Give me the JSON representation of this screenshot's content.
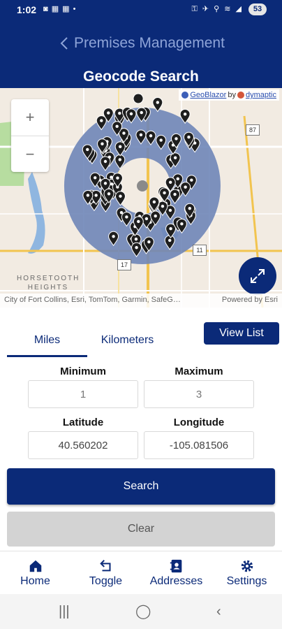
{
  "status_bar": {
    "time": "1:02",
    "left_icons": "◙ ▦ ▦ •",
    "right_icons": "⚿ ✈ ⚲ ≋ ◢",
    "battery": "53"
  },
  "header": {
    "back_label": "Premises Management",
    "title": "Geocode Search"
  },
  "map": {
    "attribution_brand": "GeoBlazor",
    "attribution_by": "by",
    "attribution_vendor": "dymaptic",
    "credits": "City of Fort Collins, Esri, TomTom, Garmin, SafeG…",
    "powered_by": "Powered by Esri",
    "place_label": "HORSETOOTH HEIGHTS",
    "zoom_in": "+",
    "zoom_out": "−",
    "shield_87": "87",
    "shield_11": "11",
    "shield_17": "17",
    "colors": {
      "buffer_ring": "#6f86b8",
      "pin": "#1e1e1e",
      "road": "#f2c44f",
      "park": "#b7dda0",
      "water": "#8fb6e0"
    }
  },
  "units": {
    "miles": "Miles",
    "kilometers": "Kilometers",
    "selected": "Miles"
  },
  "view_list_label": "View List",
  "form": {
    "minimum_label": "Minimum",
    "minimum_value": "1",
    "maximum_label": "Maximum",
    "maximum_value": "3",
    "latitude_label": "Latitude",
    "latitude_value": "40.560202",
    "longitude_label": "Longitude",
    "longitude_value": "-105.081506"
  },
  "actions": {
    "search": "Search",
    "clear": "Clear"
  },
  "nav": [
    {
      "label": "Home",
      "icon": "home-icon"
    },
    {
      "label": "Toggle",
      "icon": "toggle-arrows-icon"
    },
    {
      "label": "Addresses",
      "icon": "address-book-icon"
    },
    {
      "label": "Settings",
      "icon": "gear-icon"
    }
  ],
  "theme": {
    "primary": "#0b2a78",
    "secondary_text": "#8ea4d8"
  }
}
